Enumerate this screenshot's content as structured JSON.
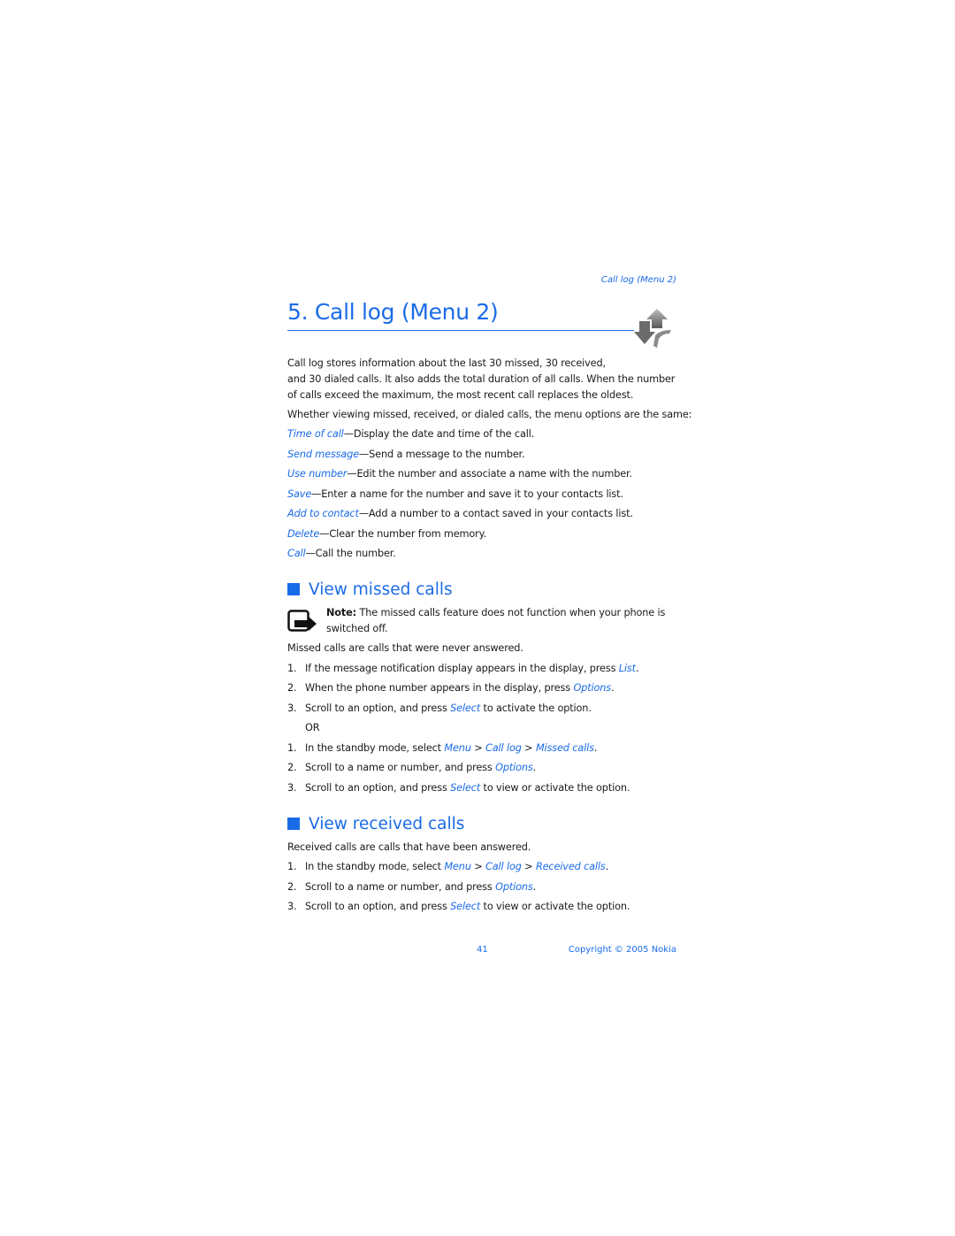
{
  "running_header": "Call log (Menu 2)",
  "chapter_title": "5.  Call log (Menu 2)",
  "intro": {
    "line1": "Call log stores information about the last 30 missed, 30 received,",
    "line2": "and 30 dialed calls. It also adds the total duration of all calls. When the number",
    "line3": "of calls exceed the maximum, the most recent call replaces the oldest.",
    "line4": "Whether viewing missed, received, or dialed calls, the menu options are the same:"
  },
  "options": [
    {
      "term": "Time of call",
      "desc": "—Display the date and time of the call."
    },
    {
      "term": "Send message",
      "desc": "—Send a message to the number."
    },
    {
      "term": "Use number",
      "desc": "—Edit the number and associate a name with the number."
    },
    {
      "term": "Save",
      "desc": "—Enter a name for the number and save it to your contacts list."
    },
    {
      "term": "Add to contact",
      "desc": "—Add a number to a contact saved in your contacts list."
    },
    {
      "term": "Delete",
      "desc": "—Clear the number from memory."
    },
    {
      "term": "Call",
      "desc": "—Call the number."
    }
  ],
  "missed": {
    "heading": "View missed calls",
    "note_label": "Note:",
    "note_line1": " The missed calls feature does not function when your phone is",
    "note_line2": "switched off.",
    "desc": "Missed calls are calls that were never answered.",
    "steps_a": [
      {
        "n": "1.",
        "pre": "If the message notification display appears in the display, press ",
        "link": "List",
        "post": "."
      },
      {
        "n": "2.",
        "pre": "When the phone number appears in the display, press ",
        "link": "Options",
        "post": "."
      },
      {
        "n": "3.",
        "pre": "Scroll to an option, and press ",
        "link": "Select",
        "post": " to activate the option."
      }
    ],
    "or": "OR",
    "steps_b": {
      "s1": {
        "n": "1.",
        "pre": "In the standby mode, select ",
        "l1": "Menu",
        "sep1": " > ",
        "l2": "Call log",
        "sep2": " > ",
        "l3": "Missed calls",
        "post": "."
      },
      "s2": {
        "n": "2.",
        "pre": "Scroll to a name or number, and press ",
        "link": "Options",
        "post": "."
      },
      "s3": {
        "n": "3.",
        "pre": "Scroll to an option, and press ",
        "link": "Select",
        "post": " to view or activate the option."
      }
    }
  },
  "received": {
    "heading": "View received calls",
    "desc": "Received calls are calls that have been answered.",
    "s1": {
      "n": "1.",
      "pre": "In the standby mode, select ",
      "l1": "Menu",
      "sep1": " > ",
      "l2": "Call log",
      "sep2": " > ",
      "l3": "Received calls",
      "post": "."
    },
    "s2": {
      "n": "2.",
      "pre": "Scroll to a name or number, and press ",
      "link": "Options",
      "post": "."
    },
    "s3": {
      "n": "3.",
      "pre": "Scroll to an option, and press ",
      "link": "Select",
      "post": " to view or activate the option."
    }
  },
  "footer": {
    "page_number": "41",
    "copyright": "Copyright © 2005 Nokia"
  }
}
